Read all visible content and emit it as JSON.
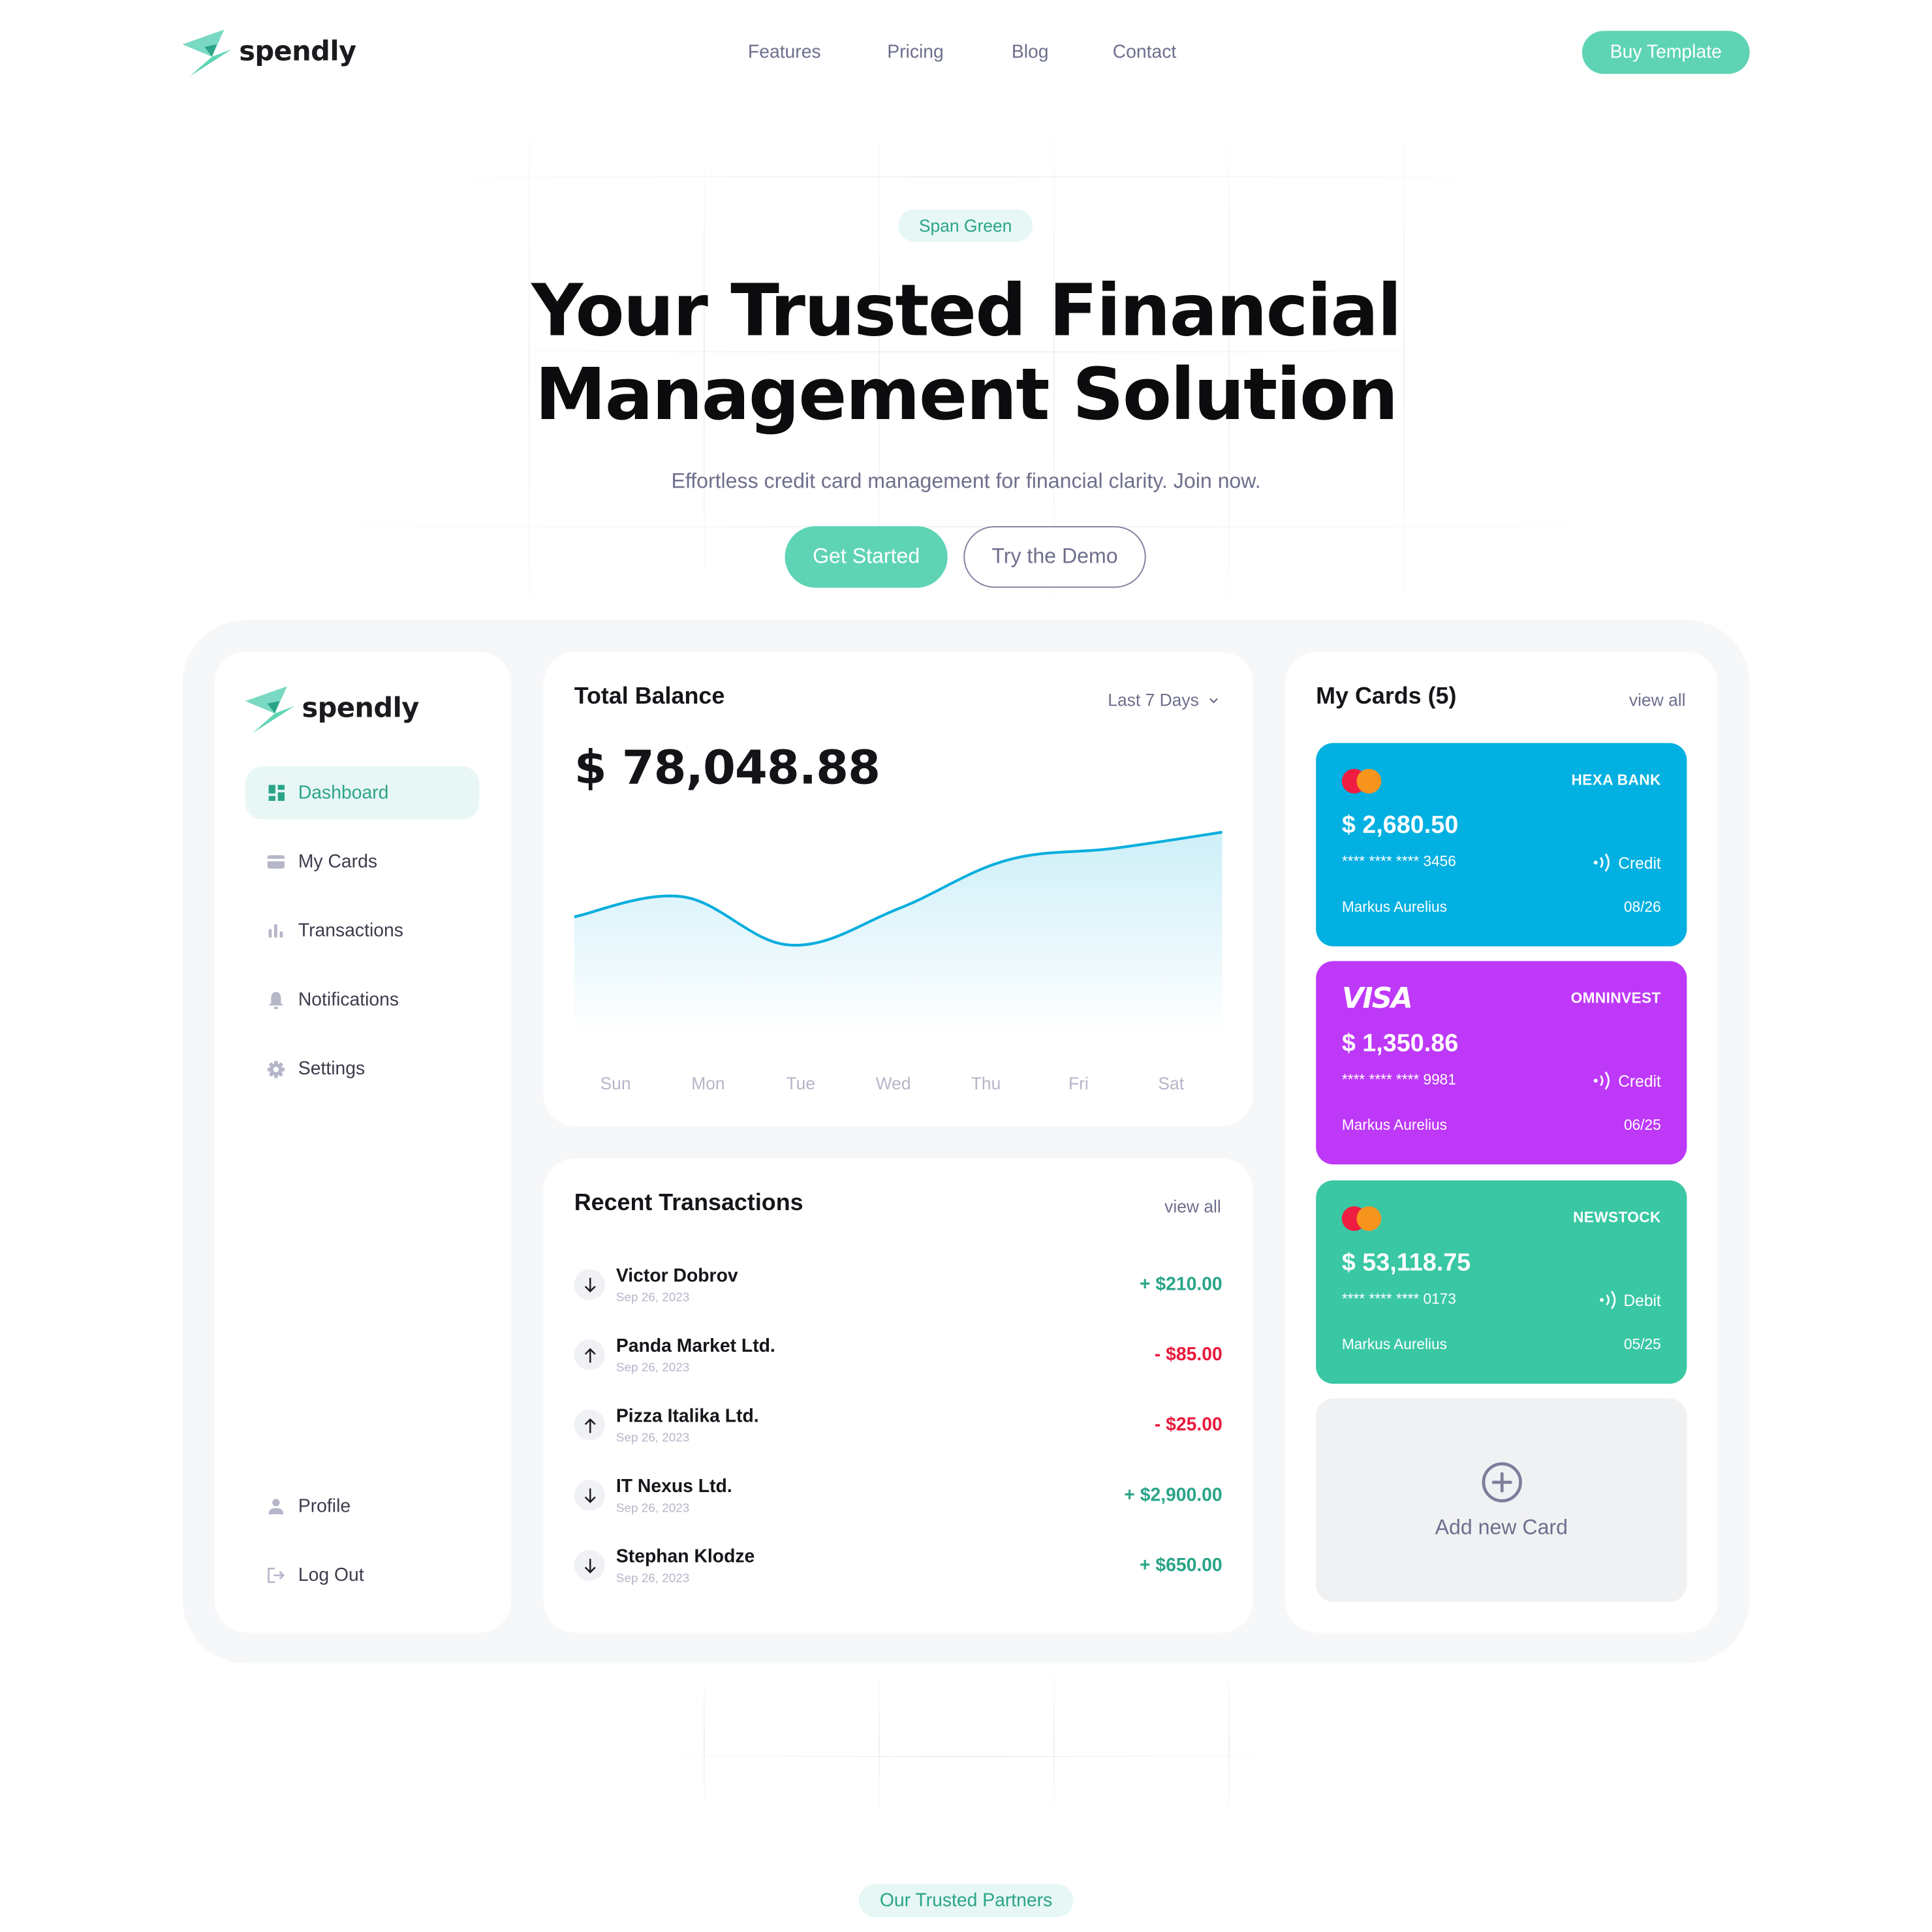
{
  "nav": {
    "brand": "spendly",
    "links": [
      "Features",
      "Pricing",
      "Blog",
      "Contact"
    ],
    "cta": "Buy Template"
  },
  "hero": {
    "badge": "Span Green",
    "title_line1": "Your Trusted Financial",
    "title_line2": "Management Solution",
    "subtitle": "Effortless credit card management for financial clarity. Join now.",
    "primary_button": "Get Started",
    "secondary_button": "Try the Demo"
  },
  "dashboard": {
    "sidebar": {
      "brand": "spendly",
      "items": [
        {
          "label": "Dashboard",
          "icon": "dashboard-icon",
          "active": true
        },
        {
          "label": "My Cards",
          "icon": "card-icon",
          "active": false
        },
        {
          "label": "Transactions",
          "icon": "bar-chart-icon",
          "active": false
        },
        {
          "label": "Notifications",
          "icon": "bell-icon",
          "active": false
        },
        {
          "label": "Settings",
          "icon": "gear-icon",
          "active": false
        }
      ],
      "bottom_items": [
        {
          "label": "Profile",
          "icon": "user-icon"
        },
        {
          "label": "Log Out",
          "icon": "logout-icon"
        }
      ]
    },
    "balance": {
      "title": "Total Balance",
      "range": "Last 7 Days",
      "amount": "$ 78,048.88"
    },
    "transactions": {
      "title": "Recent Transactions",
      "view_all": "view all",
      "rows": [
        {
          "name": "Victor Dobrov",
          "date": "Sep 26, 2023",
          "amount": "+ $210.00",
          "direction": "in"
        },
        {
          "name": "Panda Market Ltd.",
          "date": "Sep 26, 2023",
          "amount": "- $85.00",
          "direction": "out"
        },
        {
          "name": "Pizza Italika Ltd.",
          "date": "Sep 26, 2023",
          "amount": "- $25.00",
          "direction": "out"
        },
        {
          "name": "IT Nexus Ltd.",
          "date": "Sep 26, 2023",
          "amount": "+ $2,900.00",
          "direction": "in"
        },
        {
          "name": "Stephan Klodze",
          "date": "Sep 26, 2023",
          "amount": "+ $650.00",
          "direction": "in"
        }
      ]
    },
    "cards": {
      "title": "My Cards (5)",
      "view_all": "view all",
      "items": [
        {
          "network": "mastercard",
          "bank": "HEXA BANK",
          "balance": "$ 2,680.50",
          "number": "**** **** **** 3456",
          "type": "Credit",
          "holder": "Markus Aurelius",
          "expiry": "08/26",
          "color": "#02b0e1"
        },
        {
          "network": "visa",
          "network_label": "VISA",
          "bank": "OMNINVEST",
          "balance": "$ 1,350.86",
          "number": "**** **** **** 9981",
          "type": "Credit",
          "holder": "Markus Aurelius",
          "expiry": "06/25",
          "color": "#be38f8"
        },
        {
          "network": "mastercard",
          "bank": "NEWSTOCK",
          "balance": "$ 53,118.75",
          "number": "**** **** **** 0173",
          "type": "Debit",
          "holder": "Markus Aurelius",
          "expiry": "05/25",
          "color": "#39c7a4"
        }
      ],
      "add_label": "Add new Card"
    }
  },
  "partners": {
    "badge": "Our Trusted Partners"
  },
  "colors": {
    "accent": "#5fd4b5",
    "accent_text": "#2aa488",
    "positive": "#2aa488",
    "negative": "#e8193c",
    "chart_line": "#08aedd",
    "muted": "#6e6f8c"
  },
  "chart_data": {
    "type": "area",
    "title": "Total Balance",
    "categories": [
      "Sun",
      "Mon",
      "Tue",
      "Wed",
      "Thu",
      "Fri",
      "Sat"
    ],
    "series": [
      {
        "name": "Balance",
        "values": [
          58,
          68,
          44,
          62,
          86,
          92,
          100
        ]
      }
    ],
    "ylim": [
      0,
      110
    ],
    "xlabel": "",
    "ylabel": "",
    "grid": false,
    "legend": "none",
    "note": "Relative values estimated from curve shape; no y-axis shown"
  }
}
